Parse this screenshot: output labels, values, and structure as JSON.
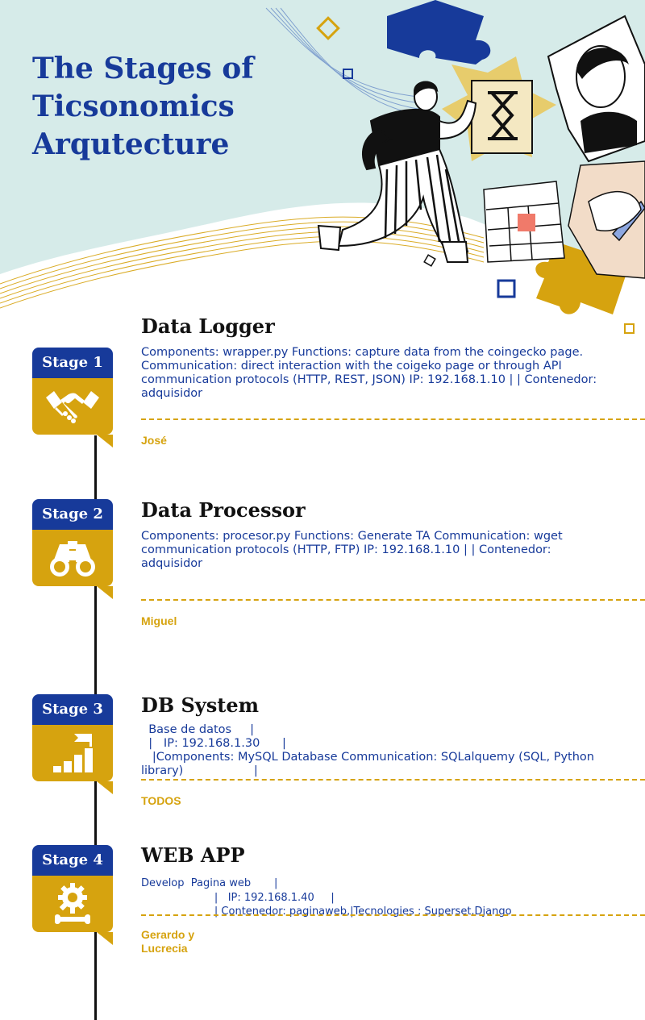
{
  "page": {
    "title_lines": [
      "The Stages of",
      "Ticsonomics",
      "Arqutecture"
    ]
  },
  "colors": {
    "navy": "#173a9a",
    "gold": "#d6a30f",
    "mint": "#d6ebe9",
    "black": "#111111"
  },
  "stages": [
    {
      "badge": "Stage 1",
      "icon": "handshake-icon",
      "title": "Data Logger",
      "description_lines": [
        "Components: wrapper.py Functions: capture data from the coingecko page.",
        "Communication: direct interaction with the coigeko page or through API",
        "communication protocols (HTTP, REST, JSON) IP: 192.168.1.10 | | Contenedor:",
        "adquisidor"
      ],
      "owner_lines": [
        "José"
      ]
    },
    {
      "badge": "Stage 2",
      "icon": "binoculars-icon",
      "title": "Data Processor",
      "description_lines": [
        "Components: procesor.py Functions: Generate TA Communication: wget",
        "communication protocols (HTTP, FTP) IP: 192.168.1.10 | | Contenedor:",
        "adquisidor"
      ],
      "owner_lines": [
        "Miguel"
      ]
    },
    {
      "badge": "Stage 3",
      "icon": "growth-chart-flag-icon",
      "title": "DB System",
      "description_lines": [
        "  Base de datos     |",
        "  |   IP: 192.168.1.30      |",
        "   |Components: MySQL Database Communication: SQLalquemy (SQL, Python",
        "library)                   |"
      ],
      "owner_lines": [
        "TODOS"
      ]
    },
    {
      "badge": "Stage 4",
      "icon": "gear-wrench-icon",
      "title": "WEB APP",
      "description_lines": [
        "Develop  Pagina web       |",
        "                      |   IP: 192.168.1.40     |",
        "                      | Contenedor: paginaweb,|Tecnologies : Superset,Django"
      ],
      "owner_lines": [
        "Gerardo y",
        "Lucrecia"
      ]
    }
  ]
}
